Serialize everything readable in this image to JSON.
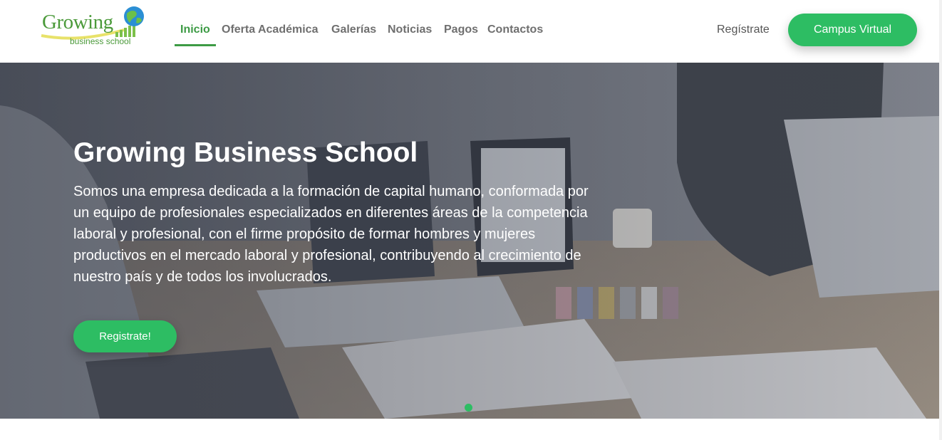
{
  "brand": {
    "name": "Growing",
    "tagline": "business school"
  },
  "nav": {
    "items": [
      {
        "label": "Inicio",
        "active": true
      },
      {
        "label": "Oferta Académica",
        "active": false
      },
      {
        "label": "Galerías",
        "active": false
      },
      {
        "label": "Noticias",
        "active": false
      },
      {
        "label": "Pagos",
        "active": false
      },
      {
        "label": "Contactos",
        "active": false
      }
    ],
    "register_label": "Regístrate",
    "campus_label": "Campus Virtual"
  },
  "hero": {
    "title": "Growing Business School",
    "description": "Somos una empresa dedicada a la formación de capital humano, conformada por un equipo de profesionales especializados en diferentes áreas de la competencia laboral y profesional, con el firme propósito de formar hombres y mujeres productivos en el mercado laboral y profesional, contribuyendo al crecimiento de nuestro país y de todos los involucrados.",
    "cta_label": "Registrate!",
    "carousel": {
      "slides": 1,
      "active": 1
    }
  },
  "colors": {
    "accent": "#2dbd63",
    "nav_active": "#3d9b45",
    "nav_text": "#6f6f6f",
    "logo_green": "#4b9a3a"
  },
  "icons": [
    "globe-icon",
    "growth-bars-icon"
  ]
}
